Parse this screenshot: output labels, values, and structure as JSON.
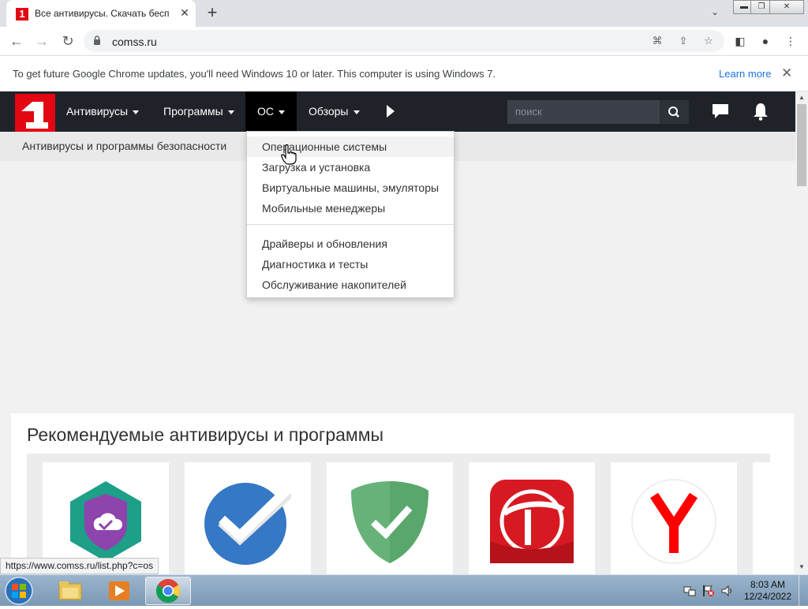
{
  "browser": {
    "tab_title": "Все антивирусы. Скачать беспл",
    "favicon_text": "1",
    "url": "comss.ru",
    "infobar_message": "To get future Google Chrome updates, you'll need Windows 10 or later. This computer is using Windows 7.",
    "infobar_link": "Learn more",
    "status_url": "https://www.comss.ru/list.php?c=os"
  },
  "site": {
    "nav": [
      {
        "label": "Антивирусы"
      },
      {
        "label": "Программы"
      },
      {
        "label": "ОС"
      },
      {
        "label": "Обзоры"
      }
    ],
    "search_placeholder": "поиск",
    "subtitle": "Антивирусы и программы безопасности",
    "dropdown": {
      "group1": [
        "Операционные системы",
        "Загрузка и установка",
        "Виртуальные машины, эмуляторы",
        "Мобильные менеджеры"
      ],
      "group2": [
        "Драйверы и обновления",
        "Диагностика и тесты",
        "Обслуживание накопителей"
      ]
    },
    "reco_title": "Рекомендуемые антивирусы и программы",
    "cards": [
      {
        "icon": "kaspersky-cloud-icon"
      },
      {
        "icon": "checkmark-circle-icon"
      },
      {
        "icon": "adguard-shield-icon"
      },
      {
        "icon": "trend-micro-icon"
      },
      {
        "icon": "yandex-browser-icon"
      }
    ],
    "accent": "#e30613"
  },
  "taskbar": {
    "time": "8:03 AM",
    "date": "12/24/2022"
  }
}
